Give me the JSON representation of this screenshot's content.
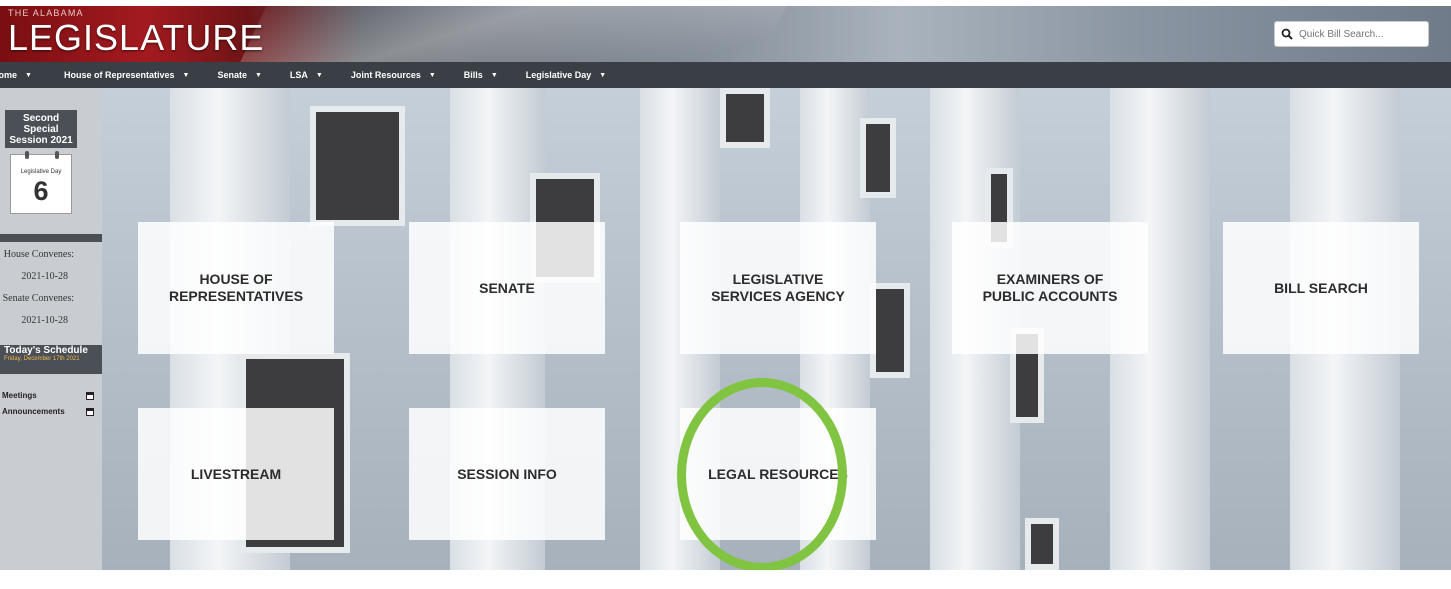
{
  "header": {
    "logo_small": "THE ALABAMA",
    "logo_big": "LEGISLATURE",
    "search_placeholder": "Quick Bill Search...",
    "search_icon": "magnifier-icon"
  },
  "nav": [
    {
      "label": "Home"
    },
    {
      "label": "House of Representatives"
    },
    {
      "label": "Senate"
    },
    {
      "label": "LSA"
    },
    {
      "label": "Joint Resources"
    },
    {
      "label": "Bills"
    },
    {
      "label": "Legislative Day"
    }
  ],
  "sidebar": {
    "session_title": "Second Special Session 2021",
    "calendar_label": "Legislative Day",
    "calendar_day": "6",
    "house_label": "House Convenes:",
    "house_date": "2021-10-28",
    "senate_label": "Senate Convenes:",
    "senate_date": "2021-10-28",
    "schedule_title": "Today's Schedule",
    "schedule_date": "Friday, December 17th 2021",
    "links": [
      {
        "label": "Meetings",
        "icon": "calendar-icon"
      },
      {
        "label": "Announcements",
        "icon": "calendar-icon"
      }
    ]
  },
  "tiles": [
    {
      "label": "HOUSE OF REPRESENTATIVES"
    },
    {
      "label": "SENATE"
    },
    {
      "label": "LEGISLATIVE SERVICES AGENCY"
    },
    {
      "label": "EXAMINERS OF PUBLIC ACCOUNTS"
    },
    {
      "label": "BILL SEARCH"
    },
    {
      "label": "LIVESTREAM"
    },
    {
      "label": "SESSION INFO"
    },
    {
      "label": "LEGAL RESOURCES"
    }
  ],
  "colors": {
    "nav_bg": "#3a3f45",
    "highlight": "#80c441",
    "brand_red": "#a31a1f",
    "schedule_date": "#f0b64a"
  }
}
